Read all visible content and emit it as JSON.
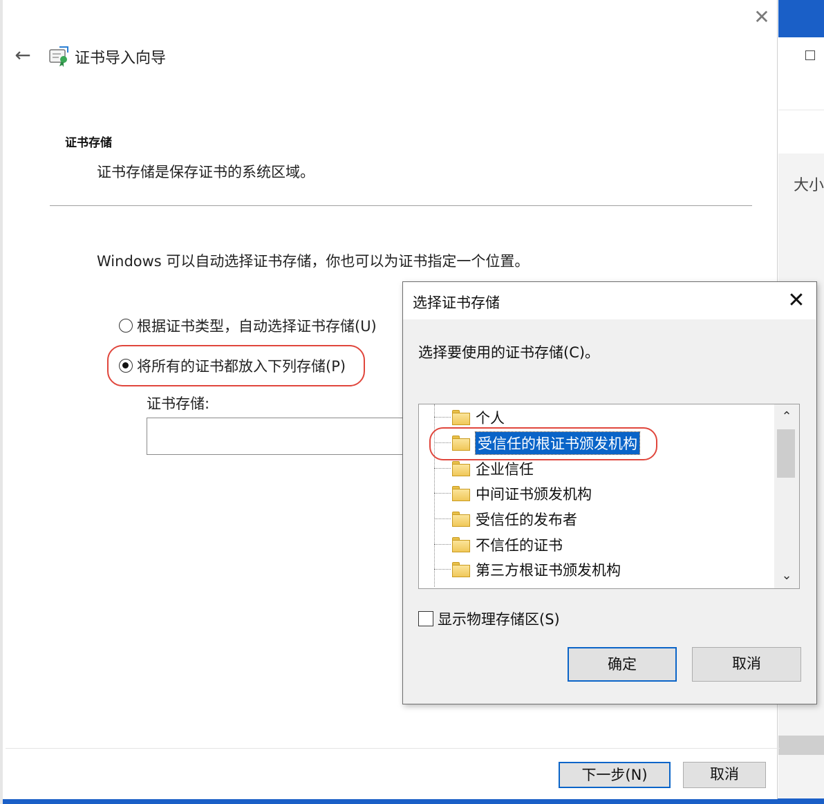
{
  "wizard": {
    "title": "证书导入向导",
    "back_glyph": "←",
    "close_glyph": "✕",
    "section_heading": "证书存储",
    "section_desc": "证书存储是保存证书的系统区域。",
    "intro": "Windows 可以自动选择证书存储，你也可以为证书指定一个位置。",
    "radio_auto_label": "根据证书类型，自动选择证书存储(U)",
    "radio_manual_label": "将所有的证书都放入下列存储(P)",
    "store_label": "证书存储:",
    "store_value": "",
    "next_label": "下一步(N)",
    "cancel_label": "取消"
  },
  "dialog": {
    "title": "选择证书存储",
    "close_glyph": "✕",
    "prompt": "选择要使用的证书存储(C)。",
    "stores": [
      "个人",
      "受信任的根证书颁发机构",
      "企业信任",
      "中间证书颁发机构",
      "受信任的发布者",
      "不信任的证书",
      "第三方根证书颁发机构"
    ],
    "selected_index": 1,
    "show_physical_label": "显示物理存储区(S)",
    "ok_label": "确定",
    "cancel_label": "取消",
    "scroll_up_glyph": "⌃",
    "scroll_down_glyph": "⌄"
  },
  "background_window": {
    "size_column": "大小"
  },
  "icons": {
    "back": "arrow-left-icon",
    "wizard": "certificate-icon",
    "folder": "folder-icon"
  },
  "colors": {
    "selection": "#0a64c8",
    "highlight_annotation": "#e0463c",
    "taskbar_blue": "#1a5fc7"
  }
}
